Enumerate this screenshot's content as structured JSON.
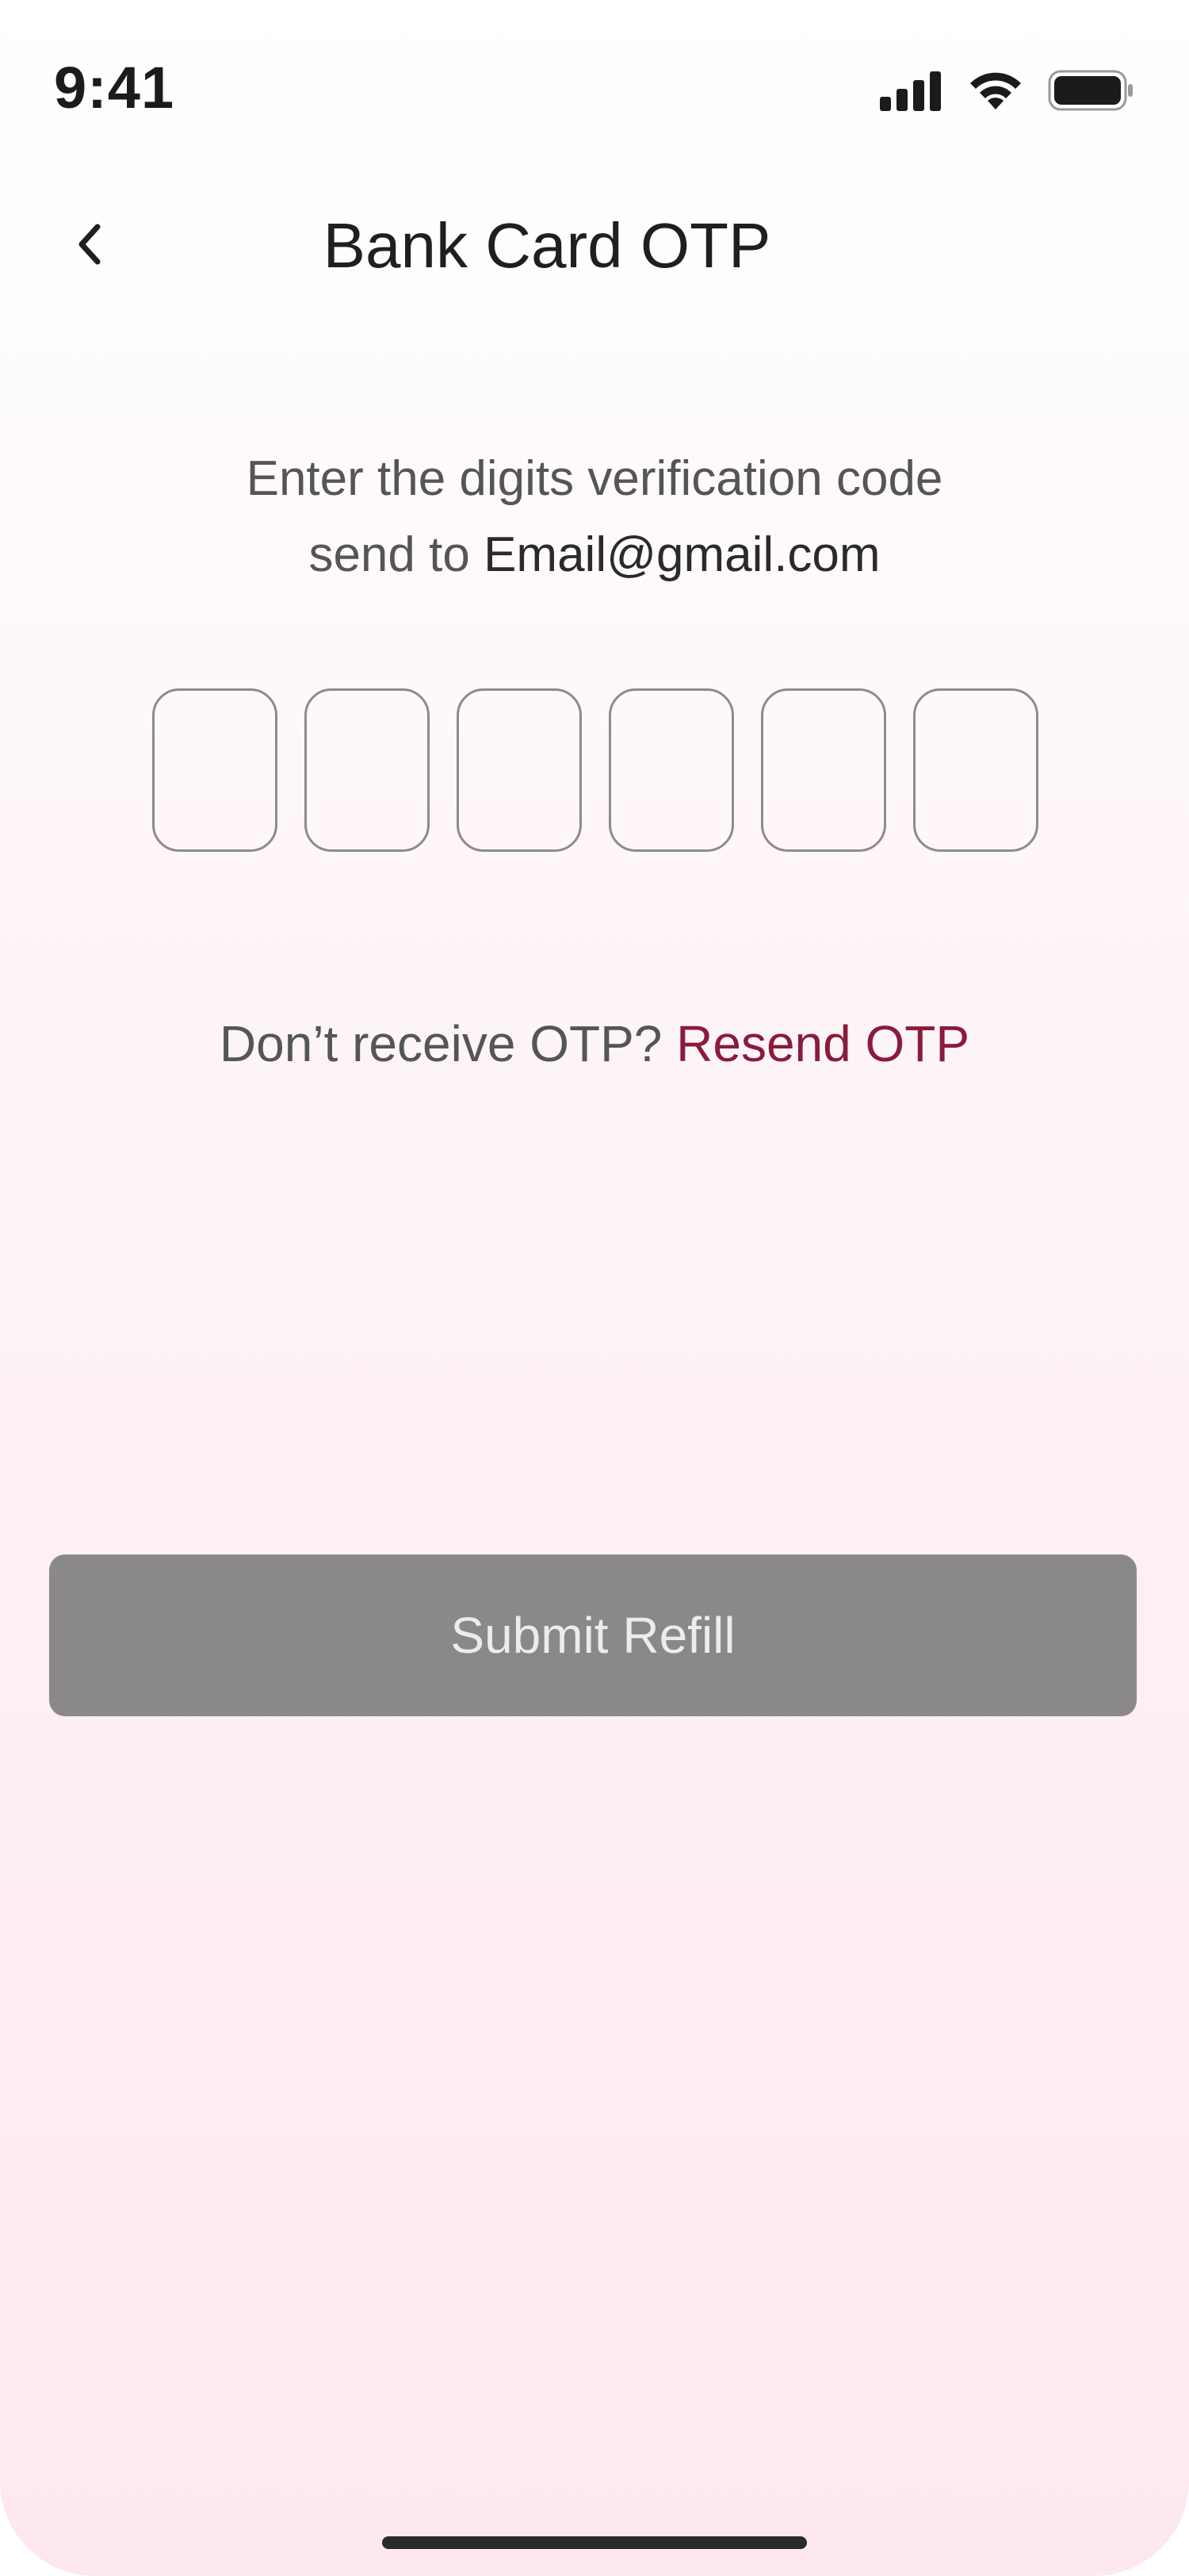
{
  "status_bar": {
    "time": "9:41",
    "icons": [
      "signal-icon",
      "wifi-icon",
      "battery-icon"
    ]
  },
  "header": {
    "back_icon": "chevron-left-icon",
    "title": "Bank Card OTP"
  },
  "instruction": {
    "line1": "Enter the digits verification code",
    "line2_prefix": "send to ",
    "email": "Email@gmail.com"
  },
  "otp": {
    "digits": [
      "",
      "",
      "",
      "",
      "",
      ""
    ]
  },
  "resend": {
    "prompt": "Don’t receive OTP? ",
    "link": "Resend OTP"
  },
  "submit": {
    "label": "Submit Refill",
    "enabled": false
  },
  "colors": {
    "accent": "#8a1b3b",
    "button_disabled": "#8a8987",
    "background_top": "#ffffff",
    "background_bottom": "#fde8ee"
  }
}
